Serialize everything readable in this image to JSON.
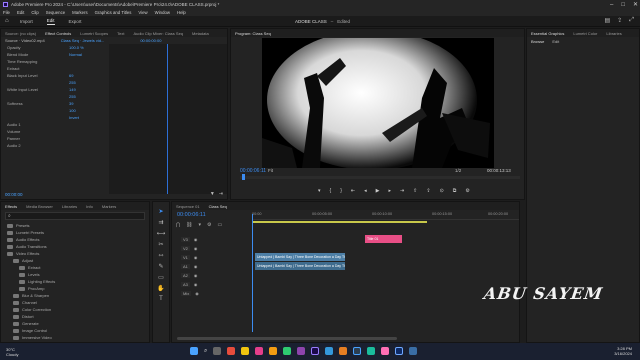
{
  "window": {
    "title": "Adobe Premiere Pro 2024 - C:\\Users\\user\\Documents\\Adobe\\Premiere Pro\\24.0\\ADOBE CLASS.prproj *"
  },
  "menu": [
    "File",
    "Edit",
    "Clip",
    "Sequence",
    "Markers",
    "Graphics and Titles",
    "View",
    "Window",
    "Help"
  ],
  "workspace": {
    "tabs": [
      "Import",
      "Edit",
      "Export"
    ],
    "active": "Edit",
    "project": "ADOBE CLASS",
    "status": "Edited"
  },
  "source_panel": {
    "tabs": [
      "Source: (no clips)",
      "Effect Controls",
      "Lumetri Scopes",
      "Text",
      "Audio Clip Mixer: Class Seq",
      "Metadata"
    ],
    "active_tab": "Effect Controls",
    "source_label": "Source · Video02.mp4",
    "clip_label": "Class Seq · Jewels vid...",
    "timecode": "00:00:00:00",
    "rows": [
      {
        "label": "Opacity",
        "value": "100.0 %"
      },
      {
        "label": "Blend Mode",
        "value": "Normal"
      },
      {
        "label": "Time Remapping",
        "value": ""
      },
      {
        "label": "Extract",
        "value": ""
      },
      {
        "label": "Black Input Level",
        "value": "69"
      },
      {
        "label": "",
        "value": "255"
      },
      {
        "label": "White Input Level",
        "value": "149"
      },
      {
        "label": "",
        "value": "255"
      },
      {
        "label": "Softness",
        "value": "39"
      },
      {
        "label": "",
        "value": "100"
      },
      {
        "label": "",
        "value": "Invert"
      },
      {
        "label": "Audio 1",
        "value": ""
      },
      {
        "label": "Volume",
        "value": ""
      },
      {
        "label": "Panner",
        "value": ""
      },
      {
        "label": "Audio 2",
        "value": ""
      }
    ],
    "bottom_timecode": "00:00:00"
  },
  "program": {
    "tab": "Program: Class Seq",
    "timecode_left": "00:00:06:11",
    "fit": "Fit",
    "quality": "1/2",
    "timecode_right": "00:00:13:13"
  },
  "essential_graphics": {
    "tabs": [
      "Essential Graphics",
      "Lumetri Color",
      "Libraries"
    ],
    "sub_tabs": [
      "Browse",
      "Edit"
    ]
  },
  "project": {
    "tabs": [
      "Effects",
      "Media Browser",
      "Libraries",
      "Info",
      "Markers"
    ],
    "active_tab": "Effects",
    "tree": [
      {
        "label": "Presets",
        "indent": 0
      },
      {
        "label": "Lumetri Presets",
        "indent": 0
      },
      {
        "label": "Audio Effects",
        "indent": 0
      },
      {
        "label": "Audio Transitions",
        "indent": 0
      },
      {
        "label": "Video Effects",
        "indent": 0
      },
      {
        "label": "Adjust",
        "indent": 1
      },
      {
        "label": "Extract",
        "indent": 2
      },
      {
        "label": "Levels",
        "indent": 2
      },
      {
        "label": "Lighting Effects",
        "indent": 2
      },
      {
        "label": "ProcAmp",
        "indent": 2
      },
      {
        "label": "Blur & Sharpen",
        "indent": 1
      },
      {
        "label": "Channel",
        "indent": 1
      },
      {
        "label": "Color Correction",
        "indent": 1
      },
      {
        "label": "Distort",
        "indent": 1
      },
      {
        "label": "Generate",
        "indent": 1
      },
      {
        "label": "Image Control",
        "indent": 1
      },
      {
        "label": "Immersive Video",
        "indent": 1
      }
    ]
  },
  "sequence": {
    "tabs": [
      "Sequence 01",
      "Class Seq"
    ],
    "active_tab": "Class Seq",
    "timecode": "00:00:06:11",
    "ruler": [
      "00:00",
      "00:00:05:00",
      "00:00:10:00",
      "00:00:15:00",
      "00:00:20:00"
    ],
    "tracks": [
      {
        "name": "V3"
      },
      {
        "name": "V2"
      },
      {
        "name": "V1"
      },
      {
        "name": "A1"
      },
      {
        "name": "A2"
      },
      {
        "name": "A3"
      },
      {
        "name": "Mix"
      }
    ],
    "clips": [
      {
        "label": "Title 01",
        "color": "#e84f86",
        "track": 0
      },
      {
        "label": "Untapped | Bambi Say | Three Bone Decoration a Day Through",
        "color": "#4d7fa6",
        "track": 2
      },
      {
        "label": "Untapped | Bambi Say | Three Bone Decoration a Day Through",
        "color": "#3f6c8e",
        "track": 3
      }
    ],
    "mix_value": "0.0"
  },
  "watermark": "ABU SAYEM",
  "taskbar": {
    "weather_temp": "30°C",
    "weather_desc": "Cloudy",
    "time": "3:28 PM",
    "date": "3/16/2024",
    "search": "Search"
  }
}
